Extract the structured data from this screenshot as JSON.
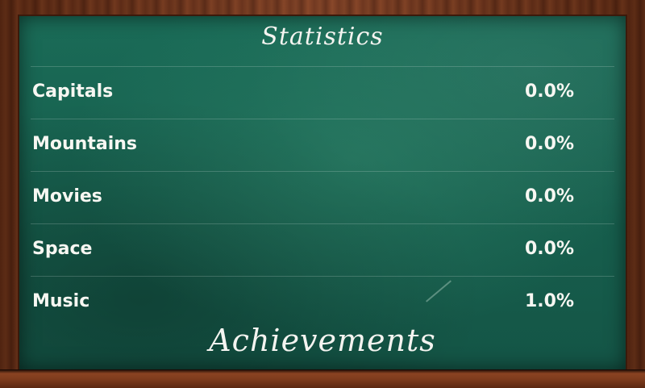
{
  "header": {
    "title": "Statistics"
  },
  "stats": [
    {
      "label": "Capitals",
      "value": "0.0%"
    },
    {
      "label": "Mountains",
      "value": "0.0%"
    },
    {
      "label": "Movies",
      "value": "0.0%"
    },
    {
      "label": "Space",
      "value": "0.0%"
    },
    {
      "label": "Music",
      "value": "1.0%"
    }
  ],
  "footer": {
    "achievements_label": "Achievements"
  }
}
